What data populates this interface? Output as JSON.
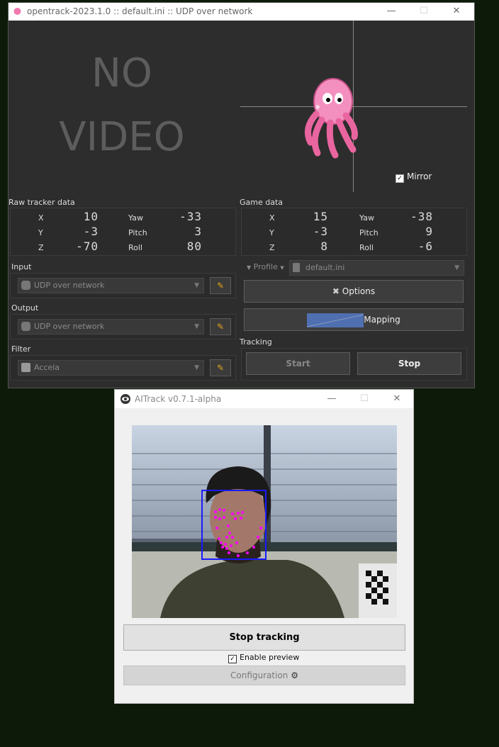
{
  "opentrack": {
    "title": "opentrack-2023.1.0 :: default.ini :: UDP over network",
    "no_video": [
      "NO",
      "VIDEO"
    ],
    "mirror_label": "Mirror",
    "raw_tracker": {
      "heading": "Raw tracker data",
      "x_label": "X",
      "x_value": "10",
      "y_label": "Y",
      "y_value": "-3",
      "z_label": "Z",
      "z_value": "-70",
      "yaw_label": "Yaw",
      "yaw_value": "-33",
      "pitch_label": "Pitch",
      "pitch_value": "3",
      "roll_label": "Roll",
      "roll_value": "80"
    },
    "game_data": {
      "heading": "Game data",
      "x_label": "X",
      "x_value": "15",
      "y_label": "Y",
      "y_value": "-3",
      "z_label": "Z",
      "z_value": "8",
      "yaw_label": "Yaw",
      "yaw_value": "-38",
      "pitch_label": "Pitch",
      "pitch_value": "9",
      "roll_label": "Roll",
      "roll_value": "-6"
    },
    "input": {
      "heading": "Input",
      "value": "UDP over network"
    },
    "output": {
      "heading": "Output",
      "value": "UDP over network"
    },
    "filter": {
      "heading": "Filter",
      "value": "Accela"
    },
    "profile": {
      "label": "Profile",
      "value": "default.ini"
    },
    "options_label": "Options",
    "mapping_label": "Mapping",
    "tracking": {
      "heading": "Tracking",
      "start_label": "Start",
      "stop_label": "Stop"
    }
  },
  "aitrack": {
    "title": "AITrack v0.7.1-alpha",
    "stop_tracking_label": "Stop tracking",
    "enable_preview_label": "Enable preview",
    "enable_preview_checked": true,
    "configuration_label": "Configuration"
  },
  "colors": {
    "accent_magenta": "#ff00ff",
    "face_box": "#1a1aff",
    "wrench": "#e3a21a"
  }
}
